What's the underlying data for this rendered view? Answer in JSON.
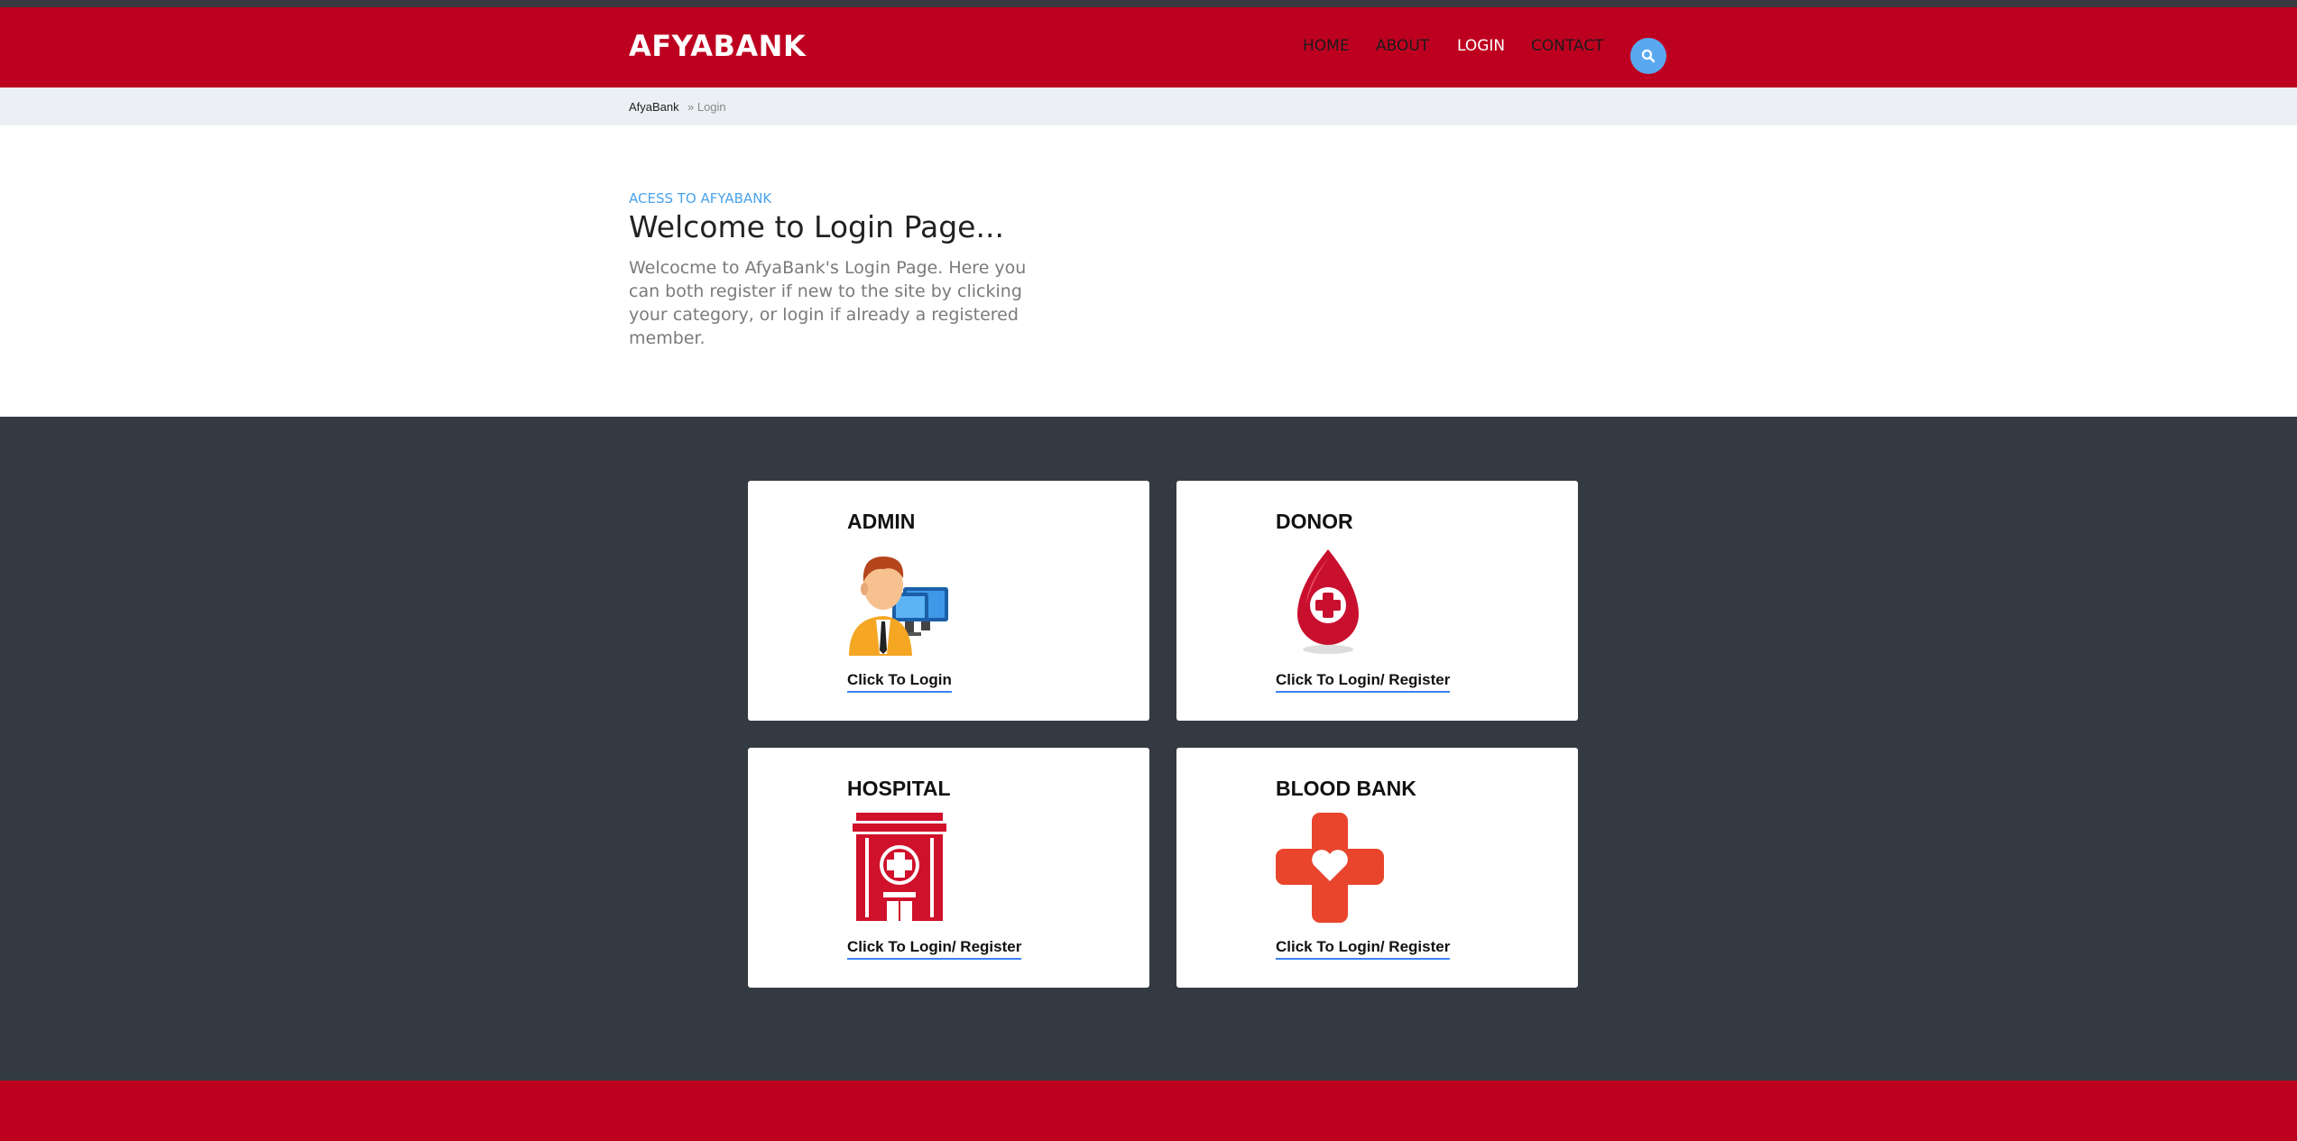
{
  "brand": "AFYABANK",
  "nav": [
    {
      "label": "HOME"
    },
    {
      "label": "ABOUT"
    },
    {
      "label": "LOGIN"
    },
    {
      "label": "CONTACT"
    }
  ],
  "search_icon": "search-icon",
  "breadcrumb": {
    "home": "AfyaBank",
    "current": "» Login"
  },
  "intro": {
    "eyebrow": "ACESS TO AFYABANK",
    "title": "Welcome to Login Page...",
    "lead": "Welcocme to AfyaBank's Login Page. Here you can both register if new to the site by clicking your category, or login if already a registered member."
  },
  "cards": [
    {
      "title": "ADMIN",
      "link": "Click To Login",
      "icon": "admin-computer-icon"
    },
    {
      "title": "DONOR",
      "link": "Click To Login/ Register",
      "icon": "blood-drop-icon"
    },
    {
      "title": "HOSPITAL",
      "link": "Click To Login/ Register",
      "icon": "hospital-building-icon"
    },
    {
      "title": "BLOOD BANK",
      "link": "Click To Login/ Register",
      "icon": "medical-cross-heart-icon"
    }
  ],
  "colors": {
    "brand_red": "#be0020",
    "dark_section": "#343a41",
    "accent_blue": "#4aa3ec"
  }
}
